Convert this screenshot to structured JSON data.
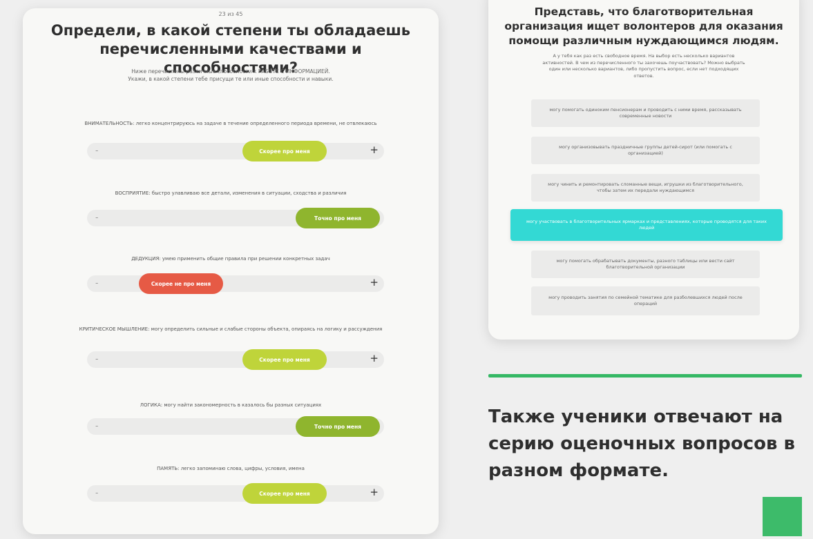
{
  "left_card": {
    "counter": "23 из 45",
    "title": "Определи, в какой степени ты обладаешь перечисленными качествами и способностями?",
    "subtitle": "Ниже перечислены различные способности к РАБОТЕ С ИНФОРМАЦИЕЙ. Укажи, в какой степени тебе присущи те или иные способности и навыки.",
    "minus": "-",
    "plus": "+",
    "questions": [
      {
        "text": "ВНИМАТЕЛЬНОСТЬ: легко концентрируюсь на задаче в течение определенного периода времени, не отвлекаюсь",
        "answer": "Скорее про меня",
        "level": 0.62
      },
      {
        "text": "ВОСПРИЯТИЕ: быстро улавливаю все детали, изменения в ситуации, сходства и различия",
        "answer": "Точно про меня",
        "level": 0.8
      },
      {
        "text": "ДЕДУКЦИЯ: умею применить общие правила при решении конкретных задач",
        "answer": "Скорее не про меня",
        "level": 0.38
      },
      {
        "text": "КРИТИЧЕСКОЕ МЫШЛЕНИЕ: могу определить сильные и слабые стороны объекта, опираясь на логику и рассуждения",
        "answer": "Скорее про меня",
        "level": 0.62
      },
      {
        "text": "ЛОГИКА: могу найти закономерность в казалось бы разных ситуациях",
        "answer": "Точно про меня",
        "level": 0.8
      },
      {
        "text": "ПАМЯТЬ: легко запоминаю слова, цифры, условия, имена",
        "answer": "Скорее про меня",
        "level": 0.62
      }
    ]
  },
  "right_card": {
    "title": "Представь, что благотворительная организация ищет волонтеров для оказания помощи различным нуждающимся людям.",
    "subtitle": "А у тебя как раз есть свободное время. На выбор есть несколько вариантов активностей. В чем из перечисленного ты захочешь поучаствовать? Можно выбрать один или несколько вариантов, либо пропустить вопрос, если нет подходящих ответов.",
    "options": [
      {
        "text": "могу помогать одиноким пенсионерам и проводить с ними время, рассказывать современные новости",
        "selected": false
      },
      {
        "text": "могу организовывать праздничные группы детей-сирот (или помогать с организацией)",
        "selected": false
      },
      {
        "text": "могу чинить и ремонтировать сломанные вещи, игрушки из благотворительного, чтобы затем их передали нуждающимся",
        "selected": false
      },
      {
        "text": "могу участвовать в благотворительных ярмарках и представлениях, которые проводятся для таких людей",
        "selected": true
      },
      {
        "text": "могу помогать обрабатывать документы, разного таблицы или вести сайт благотворительной организации",
        "selected": false
      },
      {
        "text": "могу проводить занятия по семейной тематике для разболевшихся людей после операций",
        "selected": false
      }
    ]
  },
  "caption": "Также ученики отвечают на серию оценочных вопросов в разном формате.",
  "colors": {
    "pill_light": "#bfd43a",
    "pill_green": "#8fb52e",
    "pill_red": "#e65a45",
    "selected_option": "#33d9d4",
    "accent_green": "#35b865"
  }
}
